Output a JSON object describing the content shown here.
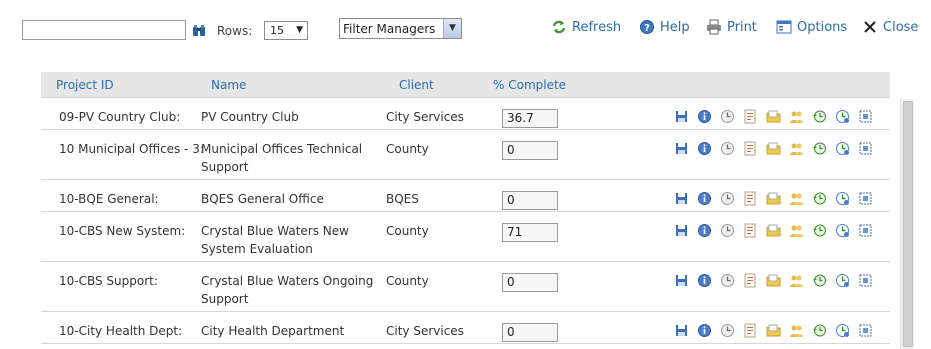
{
  "toolbar": {
    "search": {
      "value": "",
      "placeholder": ""
    },
    "rows_label": "Rows:",
    "rows_value": "15",
    "filter_value": "Filter Managers",
    "refresh": "Refresh",
    "help": "Help",
    "print": "Print",
    "options": "Options",
    "close": "Close"
  },
  "grid": {
    "columns": [
      "Project ID",
      "Name",
      "Client",
      "% Complete"
    ],
    "rows": [
      {
        "id": "09-PV Country Club:",
        "name": "PV Country Club",
        "client": "City Services",
        "pct": "36.7"
      },
      {
        "id": "10 Municipal Offices - 3:",
        "name": "Municipal Offices Technical Support",
        "client": "County",
        "pct": "0"
      },
      {
        "id": "10-BQE General:",
        "name": "BQES General Office",
        "client": "BQES",
        "pct": "0"
      },
      {
        "id": "10-CBS New System:",
        "name": "Crystal Blue Waters New System Evaluation",
        "client": "County",
        "pct": "71"
      },
      {
        "id": "10-CBS Support:",
        "name": "Crystal Blue Waters Ongoing Support",
        "client": "County",
        "pct": "0"
      },
      {
        "id": "10-City Health Dept:",
        "name": "City Health Department",
        "client": "City Services",
        "pct": "0"
      }
    ],
    "row_actions": [
      "save-icon",
      "info-icon",
      "clock-icon",
      "report-icon",
      "folder-icon",
      "users-icon",
      "history-icon",
      "schedule-icon",
      "select-icon"
    ]
  },
  "colors": {
    "link": "#2e6dab",
    "header_bg": "#e6e6e6",
    "border": "#d6d6d6"
  }
}
